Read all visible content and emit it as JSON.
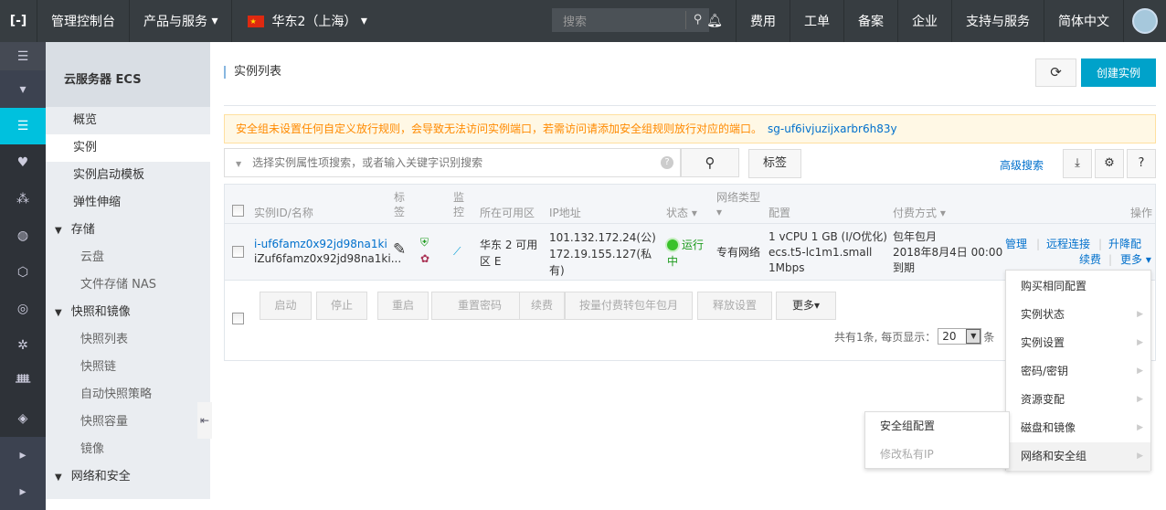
{
  "topbar": {
    "logo": "[-]",
    "console": "管理控制台",
    "products": "产品与服务",
    "region": "华东2（上海）",
    "search_placeholder": "搜索",
    "nav": [
      "费用",
      "工单",
      "备案",
      "企业",
      "支持与服务",
      "简体中文"
    ]
  },
  "sidebar": {
    "title": "云服务器 ECS",
    "items": [
      {
        "label": "概览",
        "type": "item"
      },
      {
        "label": "实例",
        "type": "item",
        "active": true
      },
      {
        "label": "实例启动模板",
        "type": "item"
      },
      {
        "label": "弹性伸缩",
        "type": "item"
      },
      {
        "label": "存储",
        "type": "group"
      },
      {
        "label": "云盘",
        "type": "sub"
      },
      {
        "label": "文件存储 NAS",
        "type": "sub"
      },
      {
        "label": "快照和镜像",
        "type": "group"
      },
      {
        "label": "快照列表",
        "type": "sub"
      },
      {
        "label": "快照链",
        "type": "sub"
      },
      {
        "label": "自动快照策略",
        "type": "sub"
      },
      {
        "label": "快照容量",
        "type": "sub"
      },
      {
        "label": "镜像",
        "type": "sub"
      },
      {
        "label": "网络和安全",
        "type": "group"
      }
    ]
  },
  "main": {
    "title": "实例列表",
    "create_label": "创建实例",
    "warning": {
      "text": "安全组未设置任何自定义放行规则，会导致无法访问实例端口，若需访问请添加安全组规则放行对应的端口。",
      "link": "sg-uf6ivjuzijxarbr6h83y"
    },
    "search_placeholder": "选择实例属性项搜索，或者输入关键字识别搜索",
    "tag_label": "标签",
    "advanced_search": "高级搜索",
    "columns": {
      "id": "实例ID/名称",
      "tag": "标签",
      "monitor": "监控",
      "zone": "所在可用区",
      "ip": "IP地址",
      "status": "状态",
      "network": "网络类型",
      "config": "配置",
      "billing": "付费方式",
      "actions": "操作"
    },
    "row": {
      "id": "i-uf6famz0x92jd98na1ki",
      "name": "iZuf6famz0x92jd98na1ki...",
      "zone": "华东 2 可用区 E",
      "ip_public": "101.132.172.24(公)",
      "ip_private": "172.19.155.127(私有)",
      "status": "运行中",
      "status_color": "#3ac22a",
      "network": "专有网络",
      "config": [
        "1 vCPU 1 GB (I/O优化)",
        "ecs.t5-lc1m1.small",
        "1Mbps"
      ],
      "billing": [
        "包年包月",
        "2018年8月4日 00:00",
        "到期"
      ],
      "actions": [
        "管理",
        "远程连接",
        "升降配",
        "续费",
        "更多"
      ]
    },
    "batch_buttons": [
      "启动",
      "停止",
      "重启",
      "重置密码",
      "续费",
      "按量付费转包年包月",
      "释放设置",
      "更多"
    ],
    "pager": {
      "total": "共有1条, 每页显示：",
      "page_size": "20",
      "unit": "条"
    }
  },
  "more_menu": [
    {
      "label": "购买相同配置",
      "sub": false
    },
    {
      "label": "实例状态",
      "sub": true
    },
    {
      "label": "实例设置",
      "sub": true
    },
    {
      "label": "密码/密钥",
      "sub": true
    },
    {
      "label": "资源变配",
      "sub": true
    },
    {
      "label": "磁盘和镜像",
      "sub": true
    },
    {
      "label": "网络和安全组",
      "sub": true
    }
  ],
  "submenu": [
    {
      "label": "安全组配置",
      "disabled": false
    },
    {
      "label": "修改私有IP",
      "disabled": true
    }
  ],
  "colors": {
    "topbar": "#373d41",
    "accent": "#00c1de",
    "primary": "#00a2ca",
    "link": "#0070cc",
    "warning": "#ff8a00"
  }
}
